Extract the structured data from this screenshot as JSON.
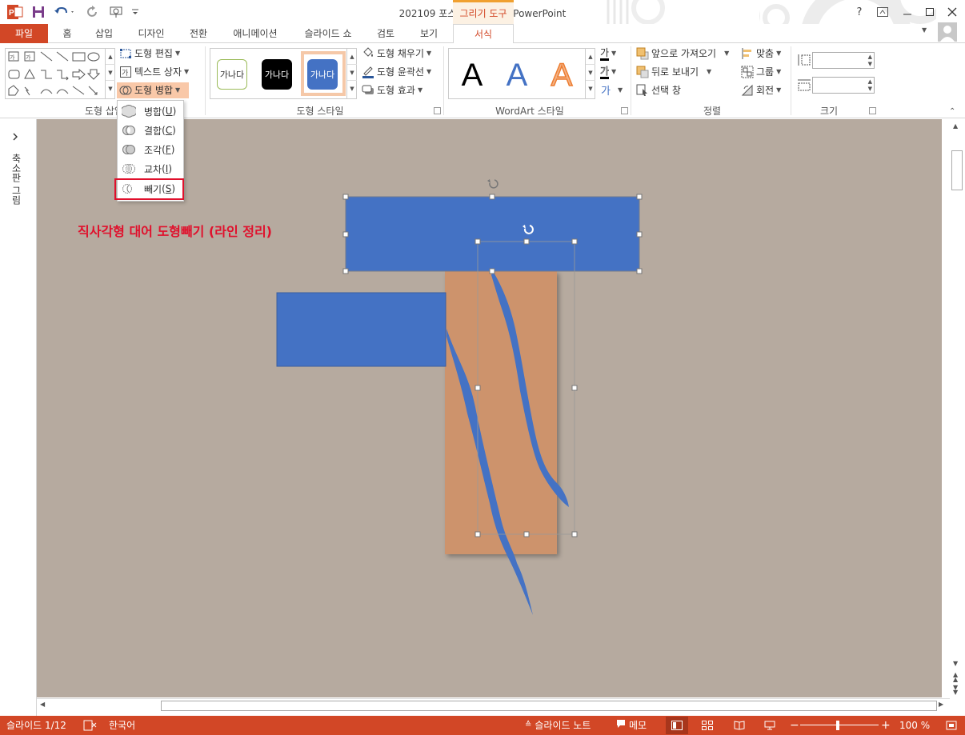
{
  "window": {
    "title": "202109 포스팅용 완성본 - PowerPoint",
    "context_tools_label": "그리기 도구",
    "help": "?"
  },
  "tabs": {
    "file": "파일",
    "home": "홈",
    "insert": "삽입",
    "design": "디자인",
    "transitions": "전환",
    "animations": "애니메이션",
    "slideshow": "슬라이드 쇼",
    "review": "검토",
    "view": "보기",
    "format": "서식"
  },
  "ribbon": {
    "insert_shapes": {
      "label": "도형 삽입",
      "edit_shape": "도형 편집",
      "text_box": "텍스트 상자",
      "merge_shapes": "도형 병합"
    },
    "shape_styles": {
      "label": "도형 스타일",
      "thumbs": [
        "가나다",
        "가나다",
        "가나다"
      ],
      "fill": "도형 채우기",
      "outline": "도형 윤곽선",
      "effects": "도형 효과"
    },
    "wordart": {
      "label": "WordArt 스타일",
      "letters": [
        "A",
        "A",
        "A"
      ],
      "text_fill_icon": "가",
      "text_outline_icon": "가"
    },
    "arrange": {
      "label": "정렬",
      "bring_forward": "앞으로 가져오기",
      "send_backward": "뒤로 보내기",
      "selection_pane": "선택 창",
      "align": "맞춤",
      "group": "그룹",
      "rotate": "회전"
    },
    "size": {
      "label": "크기",
      "height_value": "",
      "width_value": ""
    }
  },
  "merge_menu": {
    "items": [
      {
        "label": "병합",
        "key": "U"
      },
      {
        "label": "결합",
        "key": "C"
      },
      {
        "label": "조각",
        "key": "F"
      },
      {
        "label": "교차",
        "key": "I"
      },
      {
        "label": "빼기",
        "key": "S"
      }
    ],
    "highlighted": "빼기"
  },
  "left_pane": {
    "label": "축소판 그림",
    "expand_icon": "chevron-right-icon"
  },
  "slide": {
    "annotation": "직사각형 대어 도형빼기 (라인 정리)"
  },
  "statusbar": {
    "slide_counter": "슬라이드 1/12",
    "language": "한국어",
    "notes": "슬라이드 노트",
    "comments": "메모",
    "zoom": "100 %"
  },
  "colors": {
    "accent": "#d24726",
    "shape_blue": "#4472c4",
    "shape_orange": "#cd936c",
    "canvas_bg": "#b6aa9f",
    "annotation_red": "#e0102c",
    "context_tab": "#f0a030"
  }
}
